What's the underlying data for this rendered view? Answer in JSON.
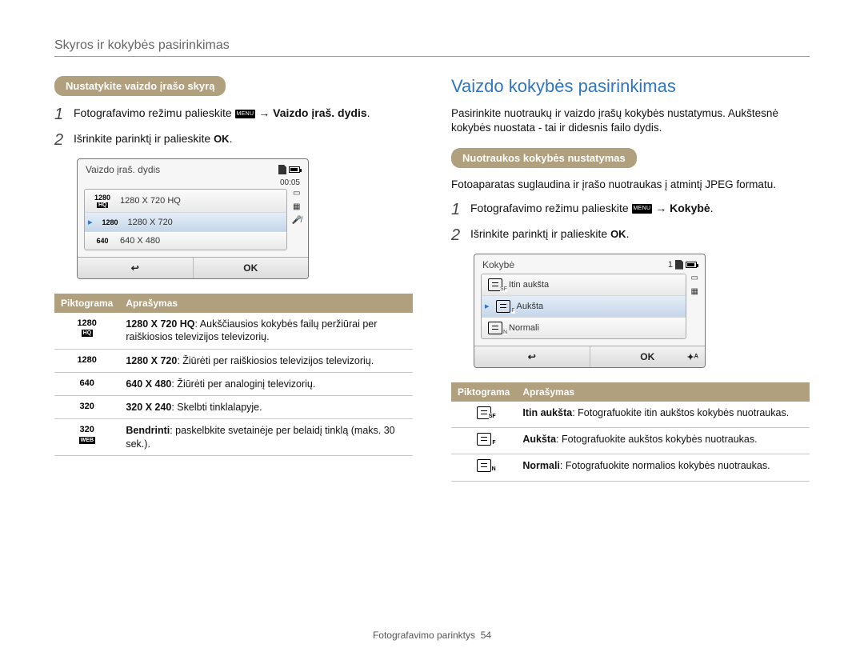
{
  "section_title": "Skyros ir kokybės pasirinkimas",
  "left": {
    "pill": "Nustatykite vaizdo įrašo skyrą",
    "step1_pre": "Fotografavimo režimu palieskite ",
    "menu_label": "MENU",
    "arrow": " → ",
    "step1_bold": "Vaizdo įraš. dydis",
    "step1_end": ".",
    "step2": "Išrinkite parinktį ir palieskite ",
    "ok": "OK",
    "step2_end": ".",
    "lcd": {
      "title": "Vaizdo įraš. dydis",
      "time": "00:05",
      "rows": [
        {
          "chip": "1280",
          "sub": "HQ",
          "label": "1280 X 720 HQ",
          "sel": false
        },
        {
          "chip": "1280",
          "sub": "",
          "label": "1280 X 720",
          "sel": true
        },
        {
          "chip": "640",
          "sub": "",
          "label": "640 X 480",
          "sel": false
        }
      ],
      "back": "↩",
      "ok": "OK"
    },
    "th_icon": "Piktograma",
    "th_desc": "Aprašymas",
    "rows": [
      {
        "icon": "1280",
        "sub": "HQ",
        "bold": "1280 X 720 HQ",
        "rest": ": Aukščiausios kokybės failų peržiūrai per raiškiosios televizijos televizorių."
      },
      {
        "icon": "1280",
        "sub": "",
        "bold": "1280 X 720",
        "rest": ": Žiūrėti per raiškiosios televizijos televizorių."
      },
      {
        "icon": "640",
        "sub": "",
        "bold": "640 X 480",
        "rest": ": Žiūrėti per analoginį televizorių."
      },
      {
        "icon": "320",
        "sub": "",
        "bold": "320 X 240",
        "rest": ": Skelbti tinklalapyje."
      },
      {
        "icon": "320",
        "sub": "WEB",
        "bold": "Bendrinti",
        "rest": ": paskelbkite svetainėje per belaidį tinklą (maks. 30 sek.)."
      }
    ]
  },
  "right": {
    "heading": "Vaizdo kokybės pasirinkimas",
    "para": "Pasirinkite nuotraukų ir vaizdo įrašų kokybės nustatymus. Aukštesnė kokybės nuostata - tai ir didesnis failo dydis.",
    "pill": "Nuotraukos kokybės nustatymas",
    "para2": "Fotoaparatas suglaudina ir įrašo nuotraukas į atmintį JPEG formatu.",
    "step1_pre": "Fotografavimo režimu palieskite ",
    "menu_label": "MENU",
    "arrow": " → ",
    "step1_bold": "Kokybė",
    "step1_end": ".",
    "step2": "Išrinkite parinktį ir palieskite ",
    "ok": "OK",
    "step2_end": ".",
    "lcd": {
      "title": "Kokybė",
      "count": "1",
      "rows": [
        {
          "q": "SF",
          "label": "Itin aukšta",
          "sel": false
        },
        {
          "q": "F",
          "label": "Aukšta",
          "sel": true
        },
        {
          "q": "N",
          "label": "Normali",
          "sel": false
        }
      ],
      "back": "↩",
      "ok": "OK",
      "corner": "✦ᴬ"
    },
    "th_icon": "Piktograma",
    "th_desc": "Aprašymas",
    "rows": [
      {
        "q": "SF",
        "bold": "Itin aukšta",
        "rest": ": Fotografuokite itin aukštos kokybės nuotraukas."
      },
      {
        "q": "F",
        "bold": "Aukšta",
        "rest": ": Fotografuokite aukštos kokybės nuotraukas."
      },
      {
        "q": "N",
        "bold": "Normali",
        "rest": ": Fotografuokite normalios kokybės nuotraukas."
      }
    ]
  },
  "footer_label": "Fotografavimo parinktys",
  "footer_page": "54"
}
